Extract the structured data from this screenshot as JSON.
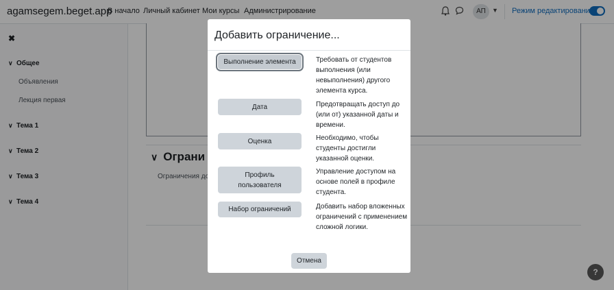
{
  "navbar": {
    "brand": "agamsegem.beget.app",
    "links": [
      "В начало",
      "Личный кабинет",
      "Мои курсы",
      "Администрирование"
    ],
    "avatar_initials": "АП",
    "edit_mode_label": "Режим редактирования",
    "edit_mode_on": true,
    "icons": [
      "bell-icon",
      "chat-icon",
      "chevron-down-icon"
    ]
  },
  "drawer": {
    "close_icon": "✖",
    "sections": [
      {
        "label": "Общее",
        "items": [
          "Объявления",
          "Лекция первая"
        ]
      },
      {
        "label": "Тема 1",
        "items": []
      },
      {
        "label": "Тема 2",
        "items": []
      },
      {
        "label": "Тема 3",
        "items": []
      },
      {
        "label": "Тема 4",
        "items": []
      }
    ]
  },
  "main": {
    "section_heading": "Ограни",
    "section_text": "Ограничения до"
  },
  "help_label": "?",
  "modal": {
    "title": "Добавить ограничение...",
    "options": [
      {
        "button": "Выполнение элемента",
        "description": "Требовать от студентов выполнения (или невыполнения) другого элемента курса."
      },
      {
        "button": "Дата",
        "description": "Предотвращать доступ до (или от) указанной даты и времени."
      },
      {
        "button": "Оценка",
        "description": "Необходимо, чтобы студенты достигли указанной оценки."
      },
      {
        "button": "Профиль пользователя",
        "description": "Управление доступом на основе полей в профиле студента."
      },
      {
        "button": "Набор ограничений",
        "description": "Добавить набор вложенных ограничений с применением сложной логики."
      }
    ],
    "cancel_label": "Отмена"
  },
  "colors": {
    "accent": "#0f6cbf",
    "button_bg": "#ced4da"
  }
}
